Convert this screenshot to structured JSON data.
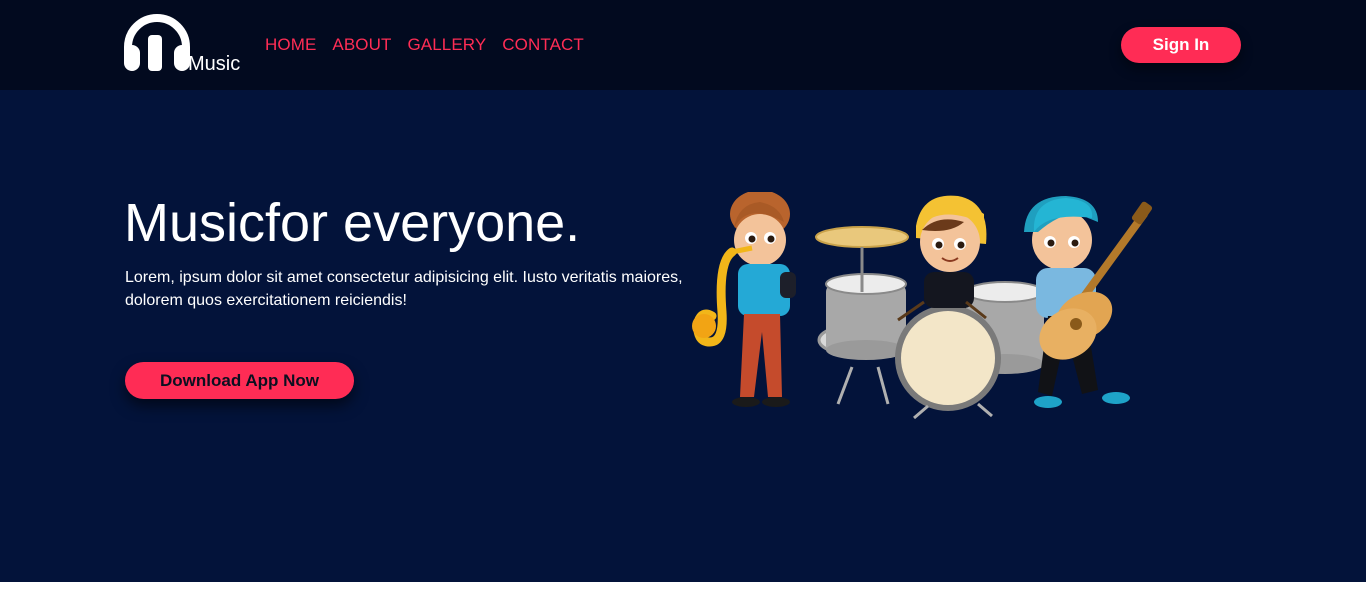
{
  "header": {
    "logo_text": "Music",
    "nav": [
      "HOME",
      "ABOUT",
      "GALLERY",
      "CONTACT"
    ],
    "signin_label": "Sign In"
  },
  "hero": {
    "title": "Musicfor everyone.",
    "text": "Lorem, ipsum dolor sit amet consectetur adipisicing elit. Iusto veritatis maiores, dolorem quos exercitationem reiciendis!",
    "cta_label": "Download App Now",
    "illustration_icon": "kids-band-illustration"
  },
  "colors": {
    "accent": "#ff2c55",
    "header_bg": "#020a1f",
    "hero_bg": "#03133a",
    "text": "#ffffff"
  }
}
